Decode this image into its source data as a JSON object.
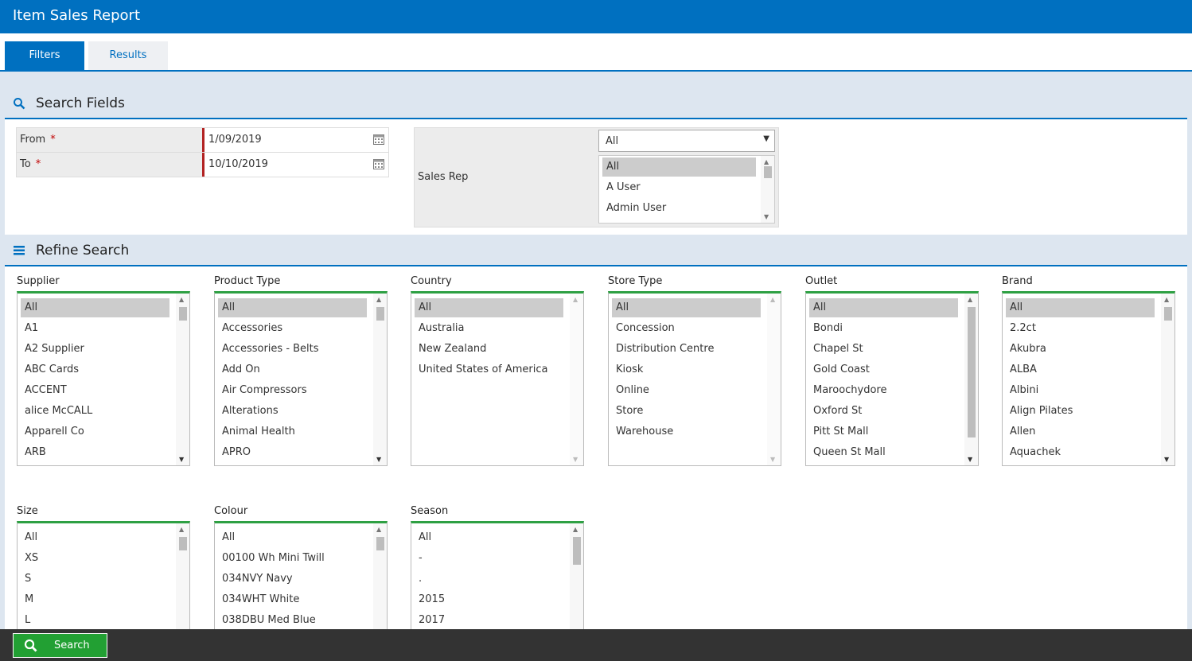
{
  "header": {
    "title": "Item Sales Report"
  },
  "tabs": [
    {
      "label": "Filters"
    },
    {
      "label": "Results"
    }
  ],
  "search_fields": {
    "heading": "Search Fields",
    "from": {
      "label": "From",
      "required_mark": "*",
      "value": "1/09/2019"
    },
    "to": {
      "label": "To",
      "required_mark": "*",
      "value": "10/10/2019"
    },
    "sales_rep": {
      "label": "Sales Rep",
      "selected": "All",
      "options": [
        "All",
        "A User",
        "Admin User"
      ]
    }
  },
  "refine_search": {
    "heading": "Refine Search",
    "supplier": {
      "label": "Supplier",
      "options": [
        "All",
        "A1",
        "A2 Supplier",
        "ABC Cards",
        "ACCENT",
        "alice McCALL",
        "Apparell Co",
        "ARB"
      ]
    },
    "product_type": {
      "label": "Product Type",
      "options": [
        "All",
        "Accessories",
        "Accessories - Belts",
        "Add On",
        "Air Compressors",
        "Alterations",
        "Animal Health",
        "APRO"
      ]
    },
    "country": {
      "label": "Country",
      "options": [
        "All",
        "Australia",
        "New Zealand",
        "United States of America"
      ]
    },
    "store_type": {
      "label": "Store Type",
      "options": [
        "All",
        "Concession",
        "Distribution Centre",
        "Kiosk",
        "Online",
        "Store",
        "Warehouse"
      ]
    },
    "outlet": {
      "label": "Outlet",
      "options": [
        "All",
        "Bondi",
        "Chapel St",
        "Gold Coast",
        "Maroochydore",
        "Oxford St",
        "Pitt St Mall",
        "Queen St Mall"
      ]
    },
    "brand": {
      "label": "Brand",
      "options": [
        "All",
        "2.2ct",
        "Akubra",
        "ALBA",
        "Albini",
        "Align Pilates",
        "Allen",
        "Aquachek"
      ]
    },
    "size": {
      "label": "Size",
      "options": [
        "All",
        "XS",
        "S",
        "M",
        "L"
      ]
    },
    "colour": {
      "label": "Colour",
      "options": [
        "All",
        "00100 Wh Mini Twill",
        "034NVY Navy",
        "034WHT White",
        "038DBU Med Blue"
      ]
    },
    "season": {
      "label": "Season",
      "options": [
        "All",
        "-",
        ".",
        "2015",
        "2017"
      ]
    }
  },
  "footer": {
    "search_label": "Search"
  },
  "colors": {
    "primary": "#0070c0",
    "accent_green": "#2ea043",
    "required": "#c00000"
  },
  "icons": {
    "search_section": "search-icon",
    "refine_section": "list-icon",
    "date_picker": "calendar-icon",
    "search_button": "search-icon"
  }
}
